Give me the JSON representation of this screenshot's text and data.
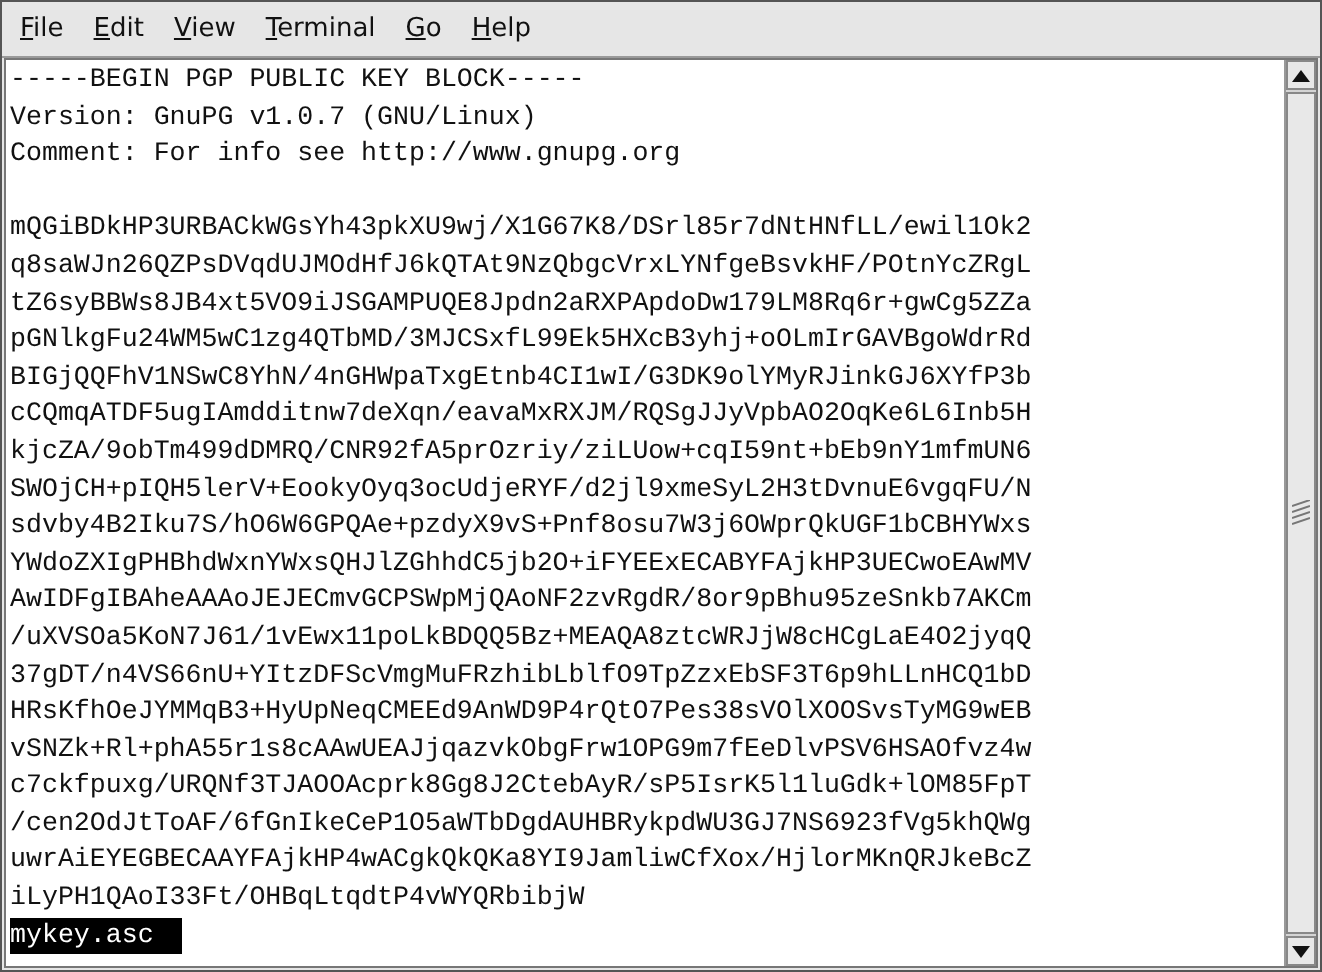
{
  "menu": [
    {
      "label": "File"
    },
    {
      "label": "Edit"
    },
    {
      "label": "View"
    },
    {
      "label": "Terminal"
    },
    {
      "label": "Go"
    },
    {
      "label": "Help"
    }
  ],
  "terminal": {
    "header": [
      "-----BEGIN PGP PUBLIC KEY BLOCK-----",
      "Version: GnuPG v1.0.7 (GNU/Linux)",
      "Comment: For info see http://www.gnupg.org"
    ],
    "key_lines": [
      "mQGiBDkHP3URBACkWGsYh43pkXU9wj/X1G67K8/DSrl85r7dNtHNfLL/ewil1Ok2",
      "q8saWJn26QZPsDVqdUJMOdHfJ6kQTAt9NzQbgcVrxLYNfgeBsvkHF/POtnYcZRgL",
      "tZ6syBBWs8JB4xt5VO9iJSGAMPUQE8Jpdn2aRXPApdoDw179LM8Rq6r+gwCg5ZZa",
      "pGNlkgFu24WM5wC1zg4QTbMD/3MJCSxfL99Ek5HXcB3yhj+oOLmIrGAVBgoWdrRd",
      "BIGjQQFhV1NSwC8YhN/4nGHWpaTxgEtnb4CI1wI/G3DK9olYMyRJinkGJ6XYfP3b",
      "cCQmqATDF5ugIAmdditnw7deXqn/eavaMxRXJM/RQSgJJyVpbAO2OqKe6L6Inb5H",
      "kjcZA/9obTm499dDMRQ/CNR92fA5prOzriy/ziLUow+cqI59nt+bEb9nY1mfmUN6",
      "SWOjCH+pIQH5lerV+EookyOyq3ocUdjeRYF/d2jl9xmeSyL2H3tDvnuE6vgqFU/N",
      "sdvby4B2Iku7S/hO6W6GPQAe+pzdyX9vS+Pnf8osu7W3j6OWprQkUGF1bCBHYWxs",
      "YWdoZXIgPHBhdWxnYWxsQHJlZGhhdC5jb2O+iFYEExECABYFAjkHP3UECwoEAwMV",
      "AwIDFgIBAheAAAoJEJECmvGCPSWpMjQAoNF2zvRgdR/8or9pBhu95zeSnkb7AKCm",
      "/uXVSOa5KoN7J61/1vEwx11poLkBDQQ5Bz+MEAQA8ztcWRJjW8cHCgLaE4O2jyqQ",
      "37gDT/n4VS66nU+YItzDFScVmgMuFRzhibLblfO9TpZzxEbSF3T6p9hLLnHCQ1bD",
      "HRsKfhOeJYMMqB3+HyUpNeqCMEEd9AnWD9P4rQtO7Pes38sVOlXOOSvsTyMG9wEB",
      "vSNZk+Rl+phA55r1s8cAAwUEAJjqazvkObgFrw1OPG9m7fEeDlvPSV6HSAOfvz4w",
      "c7ckfpuxg/URQNf3TJAOOAcprk8Gg8J2CtebAyR/sP5IsrK5l1luGdk+lOM85FpT",
      "/cen2OdJtToAF/6fGnIkeCeP1O5aWTbDgdAUHBRykpdWU3GJ7NS6923fVg5khQWg",
      "uwrAiEYEGBECAAYFAjkHP4wACgkQkQKa8YI9JamliwCfXox/HjlorMKnQRJkeBcZ",
      "iLyPH1QAoI33Ft/OHBqLtqdtP4vWYQRbibjW"
    ],
    "prompt": {
      "text": "mykey.asc",
      "selected": true
    }
  }
}
